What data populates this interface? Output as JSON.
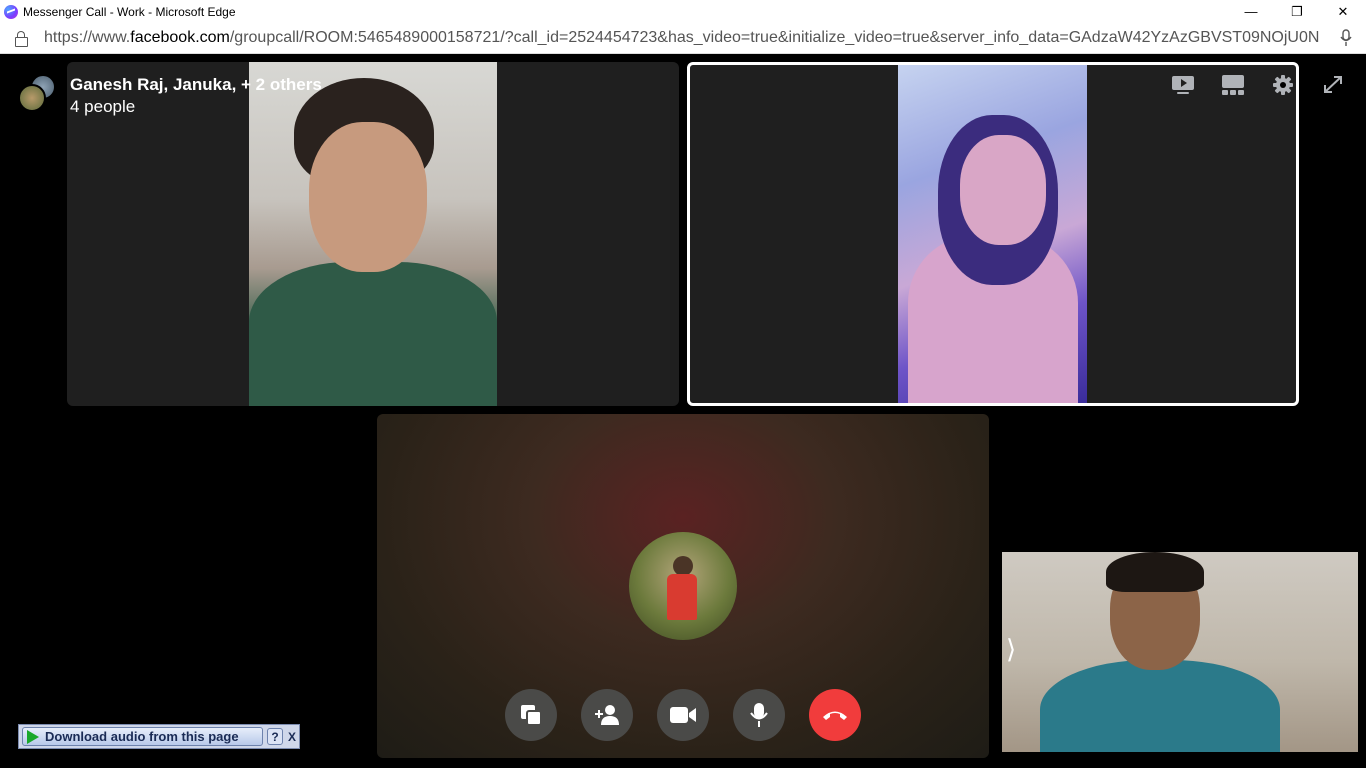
{
  "window": {
    "title": "Messenger Call - Work - Microsoft Edge",
    "controls": {
      "minimize": "—",
      "restore": "❐",
      "close": "✕"
    }
  },
  "address": {
    "url_prefix": "https://www.",
    "url_host": "facebook.com",
    "url_path": "/groupcall/ROOM:5465489000158721/?call_id=2524454723&has_video=true&initialize_video=true&server_info_data=GAdzaW42YzAzGBVST09NOjU0N..."
  },
  "call": {
    "title": "Ganesh Raj, Januka, + 2 others",
    "subtitle": "4 people"
  },
  "self_view": {
    "chevron": "⟩"
  },
  "download_bar": {
    "label": "Download audio from this page",
    "help": "?",
    "close": "X"
  }
}
